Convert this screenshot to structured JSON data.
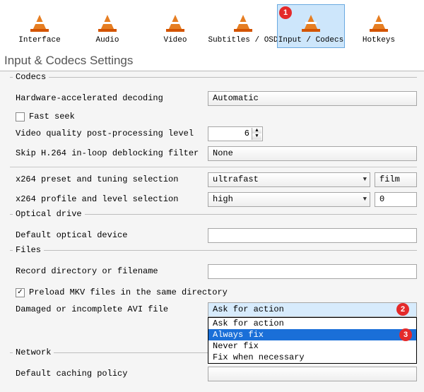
{
  "toolbar": {
    "items": [
      {
        "label": "Interface"
      },
      {
        "label": "Audio"
      },
      {
        "label": "Video"
      },
      {
        "label": "Subtitles / OSD"
      },
      {
        "label": "Input / Codecs",
        "selected": true,
        "badge": "1"
      },
      {
        "label": "Hotkeys"
      }
    ]
  },
  "heading": "Input & Codecs Settings",
  "codecs": {
    "group_title": "Codecs",
    "hw_decoding_label": "Hardware-accelerated decoding",
    "hw_decoding_value": "Automatic",
    "fast_seek_label": "Fast seek",
    "fast_seek_checked": false,
    "vq_label": "Video quality post-processing level",
    "vq_value": "6",
    "skip_h264_label": "Skip H.264 in-loop deblocking filter",
    "skip_h264_value": "None",
    "x264_preset_label": "x264 preset and tuning selection",
    "x264_preset_value": "ultrafast",
    "x264_tuning_value": "film",
    "x264_profile_label": "x264 profile and level selection",
    "x264_profile_value": "high",
    "x264_level_value": "0"
  },
  "optical": {
    "group_title": "Optical drive",
    "default_device_label": "Default optical device",
    "default_device_value": ""
  },
  "files": {
    "group_title": "Files",
    "record_dir_label": "Record directory or filename",
    "record_dir_value": "",
    "preload_mkv_label": "Preload MKV files in the same directory",
    "preload_mkv_checked": true,
    "damaged_avi_label": "Damaged or incomplete AVI file",
    "damaged_avi_selected": "Ask for action",
    "damaged_avi_badge_head": "2",
    "damaged_avi_options": [
      "Ask for action",
      "Always fix",
      "Never fix",
      "Fix when necessary"
    ],
    "damaged_avi_badge_list": "3",
    "damaged_avi_highlight_index": 1
  },
  "network": {
    "group_title": "Network",
    "caching_label": "Default caching policy"
  }
}
